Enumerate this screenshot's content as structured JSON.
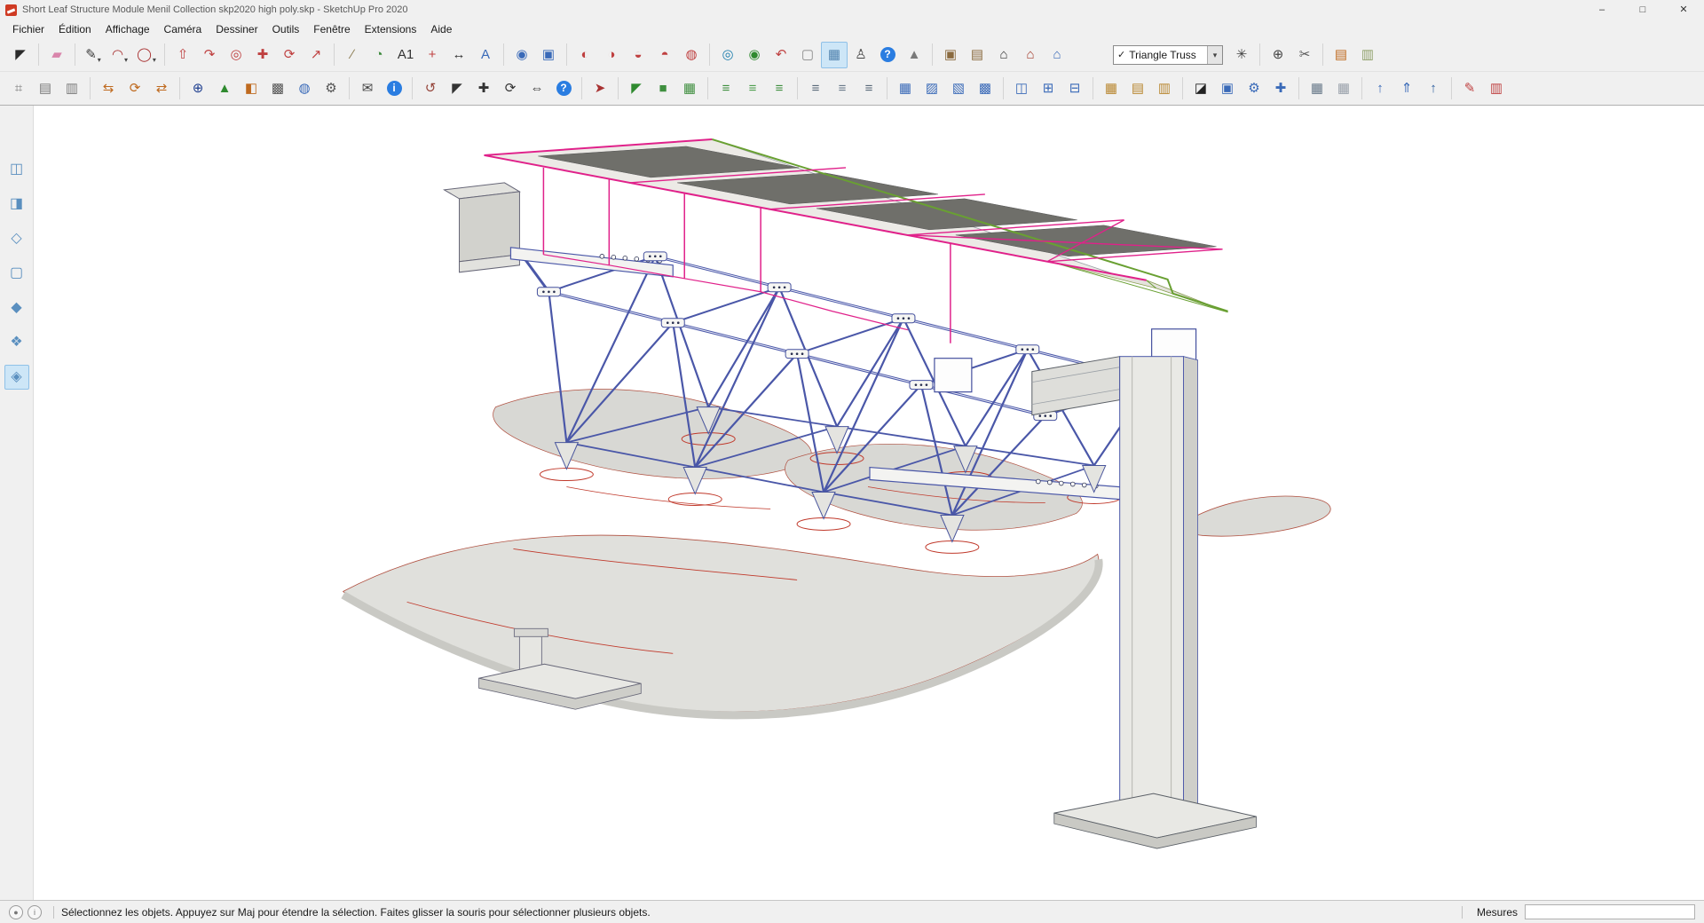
{
  "window": {
    "title": "Short Leaf Structure Module Menil Collection skp2020 high poly.skp - SketchUp Pro 2020",
    "controls": {
      "minimize": "–",
      "maximize": "□",
      "close": "✕"
    }
  },
  "ui": {
    "dropdown_arrow": "▾"
  },
  "menu": {
    "items": [
      {
        "name": "menu-fichier",
        "label": "Fichier"
      },
      {
        "name": "menu-edition",
        "label": "Édition"
      },
      {
        "name": "menu-affichage",
        "label": "Affichage"
      },
      {
        "name": "menu-camera",
        "label": "Caméra"
      },
      {
        "name": "menu-dessiner",
        "label": "Dessiner"
      },
      {
        "name": "menu-outils",
        "label": "Outils"
      },
      {
        "name": "menu-fenetre",
        "label": "Fenêtre"
      },
      {
        "name": "menu-extensions",
        "label": "Extensions"
      },
      {
        "name": "menu-aide",
        "label": "Aide"
      }
    ]
  },
  "toolbar1": {
    "items": [
      {
        "name": "select-tool",
        "glyph": "◤",
        "color": "#2b2b2b"
      },
      {
        "sep": true
      },
      {
        "name": "eraser-tool",
        "glyph": "▰",
        "color": "#d985ab"
      },
      {
        "sep": true
      },
      {
        "name": "line-tool",
        "glyph": "✎",
        "color": "#3a3a3a",
        "dd": true
      },
      {
        "name": "arc-tool",
        "glyph": "◠",
        "color": "#a83232",
        "dd": true
      },
      {
        "name": "shapes-tool",
        "glyph": "◯",
        "color": "#a83232",
        "dd": true
      },
      {
        "sep": true
      },
      {
        "name": "push-pull-tool",
        "glyph": "⇧",
        "color": "#bf4040"
      },
      {
        "name": "follow-me-tool",
        "glyph": "↷",
        "color": "#bf4040"
      },
      {
        "name": "offset-tool",
        "glyph": "◎",
        "color": "#bf4040"
      },
      {
        "name": "move-tool",
        "glyph": "✚",
        "color": "#bf4040"
      },
      {
        "name": "rotate-tool",
        "glyph": "⟳",
        "color": "#bf4040"
      },
      {
        "name": "scale-tool",
        "glyph": "↗",
        "color": "#bf4040"
      },
      {
        "sep": true
      },
      {
        "name": "tape-measure-tool",
        "glyph": "∕",
        "color": "#8a7a50"
      },
      {
        "name": "protractor-tool",
        "glyph": "◔",
        "color": "#3d8a3d"
      },
      {
        "name": "text-tool",
        "glyph": "A1",
        "color": "#333333"
      },
      {
        "name": "axes-tool",
        "glyph": "+",
        "color": "#bf4040"
      },
      {
        "name": "dimension-tool",
        "glyph": "↔",
        "color": "#333333"
      },
      {
        "name": "3d-text-tool",
        "glyph": "A",
        "color": "#3a6ab8"
      },
      {
        "sep": true
      },
      {
        "name": "zoom-tool",
        "glyph": "◉",
        "color": "#3a6ab8"
      },
      {
        "name": "zoom-window-tool",
        "glyph": "▣",
        "color": "#3a6ab8"
      },
      {
        "sep": true
      },
      {
        "name": "solid-union-tool",
        "glyph": "◐",
        "color": "#bf4040"
      },
      {
        "name": "solid-subtract-tool",
        "glyph": "◑",
        "color": "#bf4040"
      },
      {
        "name": "solid-trim-tool",
        "glyph": "◒",
        "color": "#bf4040"
      },
      {
        "name": "solid-intersect-tool",
        "glyph": "◓",
        "color": "#bf4040"
      },
      {
        "name": "soften-edges-tool",
        "glyph": "◍",
        "color": "#bf4040"
      },
      {
        "sep": true
      },
      {
        "name": "orbit-tool",
        "glyph": "◎",
        "color": "#1f7fae"
      },
      {
        "name": "zoom-extents-tool",
        "glyph": "◉",
        "color": "#2f8a2f"
      },
      {
        "name": "previous-view-tool",
        "glyph": "↶",
        "color": "#bf4040"
      },
      {
        "name": "camera-box-tool",
        "glyph": "▢",
        "color": "#8a8a8a"
      },
      {
        "name": "section-display-toggle",
        "glyph": "▦",
        "color": "#4f81ad",
        "active": true
      },
      {
        "name": "walk-tool",
        "glyph": "♙",
        "color": "#444444"
      },
      {
        "name": "help-button",
        "glyph": "?",
        "color": "#ffffff",
        "bg": "#2a7de1"
      },
      {
        "name": "shadows-toggle",
        "glyph": "▲",
        "color": "#7a7a7a"
      },
      {
        "sep": true
      },
      {
        "name": "component-box-tool",
        "glyph": "▣",
        "color": "#8a6a3f"
      },
      {
        "name": "component-sampler-tool",
        "glyph": "▤",
        "color": "#8a6a3f"
      },
      {
        "name": "3d-warehouse-tool",
        "glyph": "⌂",
        "color": "#333333"
      },
      {
        "name": "share-model-tool",
        "glyph": "⌂",
        "color": "#a33a2a"
      },
      {
        "name": "extension-warehouse-tool",
        "glyph": "⌂",
        "color": "#3a6ab8"
      }
    ],
    "combo": {
      "check": "✓",
      "value": "Triangle Truss",
      "arrow": "▾"
    },
    "items_after": [
      {
        "name": "compass-tool",
        "glyph": "✳",
        "color": "#444444"
      },
      {
        "sep": true
      },
      {
        "name": "crosshair-tool",
        "glyph": "⊕",
        "color": "#444444"
      },
      {
        "name": "axe-tool",
        "glyph": "✂",
        "color": "#555555"
      },
      {
        "sep": true
      },
      {
        "name": "layers-stack-tool",
        "glyph": "▤",
        "color": "#bf6a1f"
      },
      {
        "name": "layers-flat-tool",
        "glyph": "▥",
        "color": "#8fa06a"
      }
    ]
  },
  "toolbar2": {
    "items": [
      {
        "name": "grid-paper-tool",
        "glyph": "⌗",
        "color": "#7a7a7a"
      },
      {
        "name": "image-page-tool",
        "glyph": "▤",
        "color": "#7a7a7a"
      },
      {
        "name": "doc-page-tool",
        "glyph": "▥",
        "color": "#7a7a7a"
      },
      {
        "sep": true
      },
      {
        "name": "import-tool",
        "glyph": "⇆",
        "color": "#bf6a1f"
      },
      {
        "name": "refresh-tool",
        "glyph": "⟳",
        "color": "#bf6a1f"
      },
      {
        "name": "export-tool",
        "glyph": "⇄",
        "color": "#bf6a1f"
      },
      {
        "sep": true
      },
      {
        "name": "add-circle-tool",
        "glyph": "⊕",
        "color": "#1f3f8f"
      },
      {
        "name": "terrain-tool",
        "glyph": "▲",
        "color": "#2f8a2f"
      },
      {
        "name": "gradient-tool",
        "glyph": "◧",
        "color": "#bf6a1f"
      },
      {
        "name": "checker-tool",
        "glyph": "▩",
        "color": "#555555"
      },
      {
        "name": "globe-tool",
        "glyph": "◍",
        "color": "#3a6ab8"
      },
      {
        "name": "gear-tool",
        "glyph": "⚙",
        "color": "#555555"
      },
      {
        "sep": true
      },
      {
        "name": "mail-tool",
        "glyph": "✉",
        "color": "#444444"
      },
      {
        "name": "info-button",
        "glyph": "i",
        "color": "#ffffff",
        "bg": "#2a7de1"
      },
      {
        "sep": true
      },
      {
        "name": "undo-arc-tool",
        "glyph": "↺",
        "color": "#95453a"
      },
      {
        "name": "cursor-plus-tool",
        "glyph": "◤",
        "color": "#333333"
      },
      {
        "name": "move-all-tool",
        "glyph": "✚",
        "color": "#333333"
      },
      {
        "name": "rotate-all-tool",
        "glyph": "⟳",
        "color": "#333333"
      },
      {
        "name": "mirror-tool",
        "glyph": "⇔",
        "color": "#333333"
      },
      {
        "name": "help-2-button",
        "glyph": "?",
        "color": "#ffffff",
        "bg": "#2a7de1"
      },
      {
        "sep": true
      },
      {
        "name": "red-arrow-tool",
        "glyph": "➤",
        "color": "#a83232"
      },
      {
        "sep": true
      },
      {
        "name": "select-green-tool",
        "glyph": "◤",
        "color": "#2f8a2f"
      },
      {
        "name": "face-green-tool",
        "glyph": "■",
        "color": "#3f8f3f"
      },
      {
        "name": "grid-green-tool",
        "glyph": "▦",
        "color": "#3f8f3f"
      },
      {
        "sep": true
      },
      {
        "name": "align-top-tool",
        "glyph": "≡",
        "color": "#3f8f3f"
      },
      {
        "name": "align-middle-tool",
        "glyph": "≡",
        "color": "#4f9f4f"
      },
      {
        "name": "align-bottom-tool",
        "glyph": "≡",
        "color": "#3f8f3f"
      },
      {
        "sep": true
      },
      {
        "name": "distribute-1-tool",
        "glyph": "≡",
        "color": "#5a6a7a"
      },
      {
        "name": "distribute-2-tool",
        "glyph": "≡",
        "color": "#6a7a8a"
      },
      {
        "name": "distribute-3-tool",
        "glyph": "≡",
        "color": "#5a6a7a"
      },
      {
        "sep": true
      },
      {
        "name": "grid-xy-tool",
        "glyph": "▦",
        "color": "#3a6ab8"
      },
      {
        "name": "grid-diag-tool",
        "glyph": "▨",
        "color": "#3a6ab8"
      },
      {
        "name": "grid-diag2-tool",
        "glyph": "▧",
        "color": "#3a6ab8"
      },
      {
        "name": "grid-dense-tool",
        "glyph": "▩",
        "color": "#3a6ab8"
      },
      {
        "sep": true
      },
      {
        "name": "window-split-tool",
        "glyph": "◫",
        "color": "#3a6ab8"
      },
      {
        "name": "window-grid-tool",
        "glyph": "⊞",
        "color": "#3a6ab8"
      },
      {
        "name": "window-stack-tool",
        "glyph": "⊟",
        "color": "#3a6ab8"
      },
      {
        "sep": true
      },
      {
        "name": "table-tool",
        "glyph": "▦",
        "color": "#b8862f"
      },
      {
        "name": "table-rows-tool",
        "glyph": "▤",
        "color": "#b8862f"
      },
      {
        "name": "table-cols-tool",
        "glyph": "▥",
        "color": "#b8862f"
      },
      {
        "sep": true
      },
      {
        "name": "contrast-tool",
        "glyph": "◪",
        "color": "#222222"
      },
      {
        "name": "copy-style-tool",
        "glyph": "▣",
        "color": "#3a6ab8"
      },
      {
        "name": "gear-arrows-tool",
        "glyph": "⚙",
        "color": "#3a6ab8"
      },
      {
        "name": "plus-grid-tool",
        "glyph": "✚",
        "color": "#3a6ab8"
      },
      {
        "sep": true
      },
      {
        "name": "sheet-grid-tool",
        "glyph": "▦",
        "color": "#667788"
      },
      {
        "name": "sheet-grid-2-tool",
        "glyph": "▦",
        "color": "#99a0aa"
      },
      {
        "sep": true
      },
      {
        "name": "raise-1-tool",
        "glyph": "↑",
        "color": "#3a6ab8"
      },
      {
        "name": "raise-2-tool",
        "glyph": "⇑",
        "color": "#3a6ab8"
      },
      {
        "name": "raise-3-tool",
        "glyph": "↑",
        "color": "#2f5f9f"
      },
      {
        "sep": true
      },
      {
        "name": "red-pencil-tool",
        "glyph": "✎",
        "color": "#bf4040"
      },
      {
        "name": "red-sheet-tool",
        "glyph": "▥",
        "color": "#bf4040"
      }
    ]
  },
  "styles_toolbar": {
    "items": [
      {
        "name": "style-xray",
        "glyph": "◫",
        "color": "#5a8fbf"
      },
      {
        "name": "style-back-edges",
        "glyph": "◨",
        "color": "#5a8fbf"
      },
      {
        "name": "style-wireframe",
        "glyph": "◇",
        "color": "#5a8fbf"
      },
      {
        "name": "style-hidden-line",
        "glyph": "▢",
        "color": "#5a8fbf"
      },
      {
        "name": "style-shaded",
        "glyph": "◆",
        "color": "#5a8fbf"
      },
      {
        "name": "style-shaded-textures",
        "glyph": "❖",
        "color": "#5a8fbf"
      },
      {
        "name": "style-monochrome",
        "glyph": "◈",
        "color": "#5a8fbf",
        "active": true
      }
    ]
  },
  "statusbar": {
    "geo_icon": "●",
    "info_icon": "i",
    "message": "Sélectionnez les objets. Appuyez sur Maj pour étendre la sélection. Faites glisser la souris pour sélectionner plusieurs objets.",
    "measurements_label": "Mesures",
    "measurements_value": ""
  },
  "colors": {
    "selection_blue": "#4a57a8",
    "profile_pink": "#e0218a",
    "layer_green": "#69a032",
    "edge_red": "#c0392b",
    "active_button_bg": "#cde6f7"
  }
}
